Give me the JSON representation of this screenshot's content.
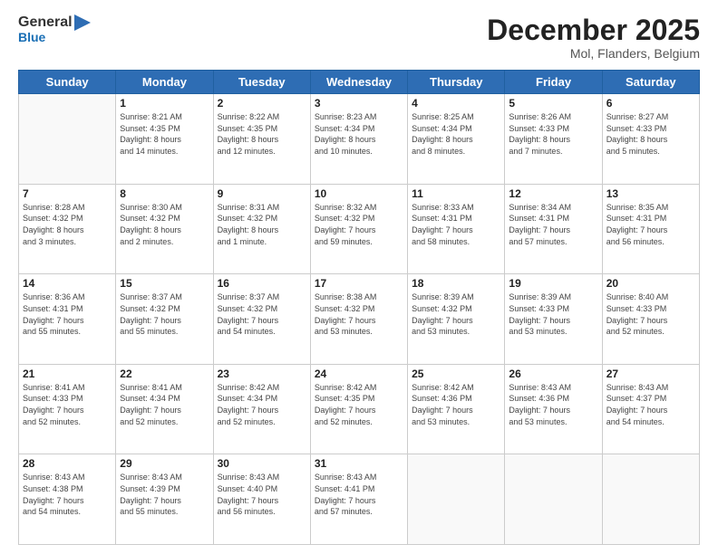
{
  "header": {
    "logo_line1": "General",
    "logo_line2": "Blue",
    "month": "December 2025",
    "location": "Mol, Flanders, Belgium"
  },
  "weekdays": [
    "Sunday",
    "Monday",
    "Tuesday",
    "Wednesday",
    "Thursday",
    "Friday",
    "Saturday"
  ],
  "weeks": [
    [
      {
        "day": "",
        "info": ""
      },
      {
        "day": "1",
        "info": "Sunrise: 8:21 AM\nSunset: 4:35 PM\nDaylight: 8 hours\nand 14 minutes."
      },
      {
        "day": "2",
        "info": "Sunrise: 8:22 AM\nSunset: 4:35 PM\nDaylight: 8 hours\nand 12 minutes."
      },
      {
        "day": "3",
        "info": "Sunrise: 8:23 AM\nSunset: 4:34 PM\nDaylight: 8 hours\nand 10 minutes."
      },
      {
        "day": "4",
        "info": "Sunrise: 8:25 AM\nSunset: 4:34 PM\nDaylight: 8 hours\nand 8 minutes."
      },
      {
        "day": "5",
        "info": "Sunrise: 8:26 AM\nSunset: 4:33 PM\nDaylight: 8 hours\nand 7 minutes."
      },
      {
        "day": "6",
        "info": "Sunrise: 8:27 AM\nSunset: 4:33 PM\nDaylight: 8 hours\nand 5 minutes."
      }
    ],
    [
      {
        "day": "7",
        "info": "Sunrise: 8:28 AM\nSunset: 4:32 PM\nDaylight: 8 hours\nand 3 minutes."
      },
      {
        "day": "8",
        "info": "Sunrise: 8:30 AM\nSunset: 4:32 PM\nDaylight: 8 hours\nand 2 minutes."
      },
      {
        "day": "9",
        "info": "Sunrise: 8:31 AM\nSunset: 4:32 PM\nDaylight: 8 hours\nand 1 minute."
      },
      {
        "day": "10",
        "info": "Sunrise: 8:32 AM\nSunset: 4:32 PM\nDaylight: 7 hours\nand 59 minutes."
      },
      {
        "day": "11",
        "info": "Sunrise: 8:33 AM\nSunset: 4:31 PM\nDaylight: 7 hours\nand 58 minutes."
      },
      {
        "day": "12",
        "info": "Sunrise: 8:34 AM\nSunset: 4:31 PM\nDaylight: 7 hours\nand 57 minutes."
      },
      {
        "day": "13",
        "info": "Sunrise: 8:35 AM\nSunset: 4:31 PM\nDaylight: 7 hours\nand 56 minutes."
      }
    ],
    [
      {
        "day": "14",
        "info": "Sunrise: 8:36 AM\nSunset: 4:31 PM\nDaylight: 7 hours\nand 55 minutes."
      },
      {
        "day": "15",
        "info": "Sunrise: 8:37 AM\nSunset: 4:32 PM\nDaylight: 7 hours\nand 55 minutes."
      },
      {
        "day": "16",
        "info": "Sunrise: 8:37 AM\nSunset: 4:32 PM\nDaylight: 7 hours\nand 54 minutes."
      },
      {
        "day": "17",
        "info": "Sunrise: 8:38 AM\nSunset: 4:32 PM\nDaylight: 7 hours\nand 53 minutes."
      },
      {
        "day": "18",
        "info": "Sunrise: 8:39 AM\nSunset: 4:32 PM\nDaylight: 7 hours\nand 53 minutes."
      },
      {
        "day": "19",
        "info": "Sunrise: 8:39 AM\nSunset: 4:33 PM\nDaylight: 7 hours\nand 53 minutes."
      },
      {
        "day": "20",
        "info": "Sunrise: 8:40 AM\nSunset: 4:33 PM\nDaylight: 7 hours\nand 52 minutes."
      }
    ],
    [
      {
        "day": "21",
        "info": "Sunrise: 8:41 AM\nSunset: 4:33 PM\nDaylight: 7 hours\nand 52 minutes."
      },
      {
        "day": "22",
        "info": "Sunrise: 8:41 AM\nSunset: 4:34 PM\nDaylight: 7 hours\nand 52 minutes."
      },
      {
        "day": "23",
        "info": "Sunrise: 8:42 AM\nSunset: 4:34 PM\nDaylight: 7 hours\nand 52 minutes."
      },
      {
        "day": "24",
        "info": "Sunrise: 8:42 AM\nSunset: 4:35 PM\nDaylight: 7 hours\nand 52 minutes."
      },
      {
        "day": "25",
        "info": "Sunrise: 8:42 AM\nSunset: 4:36 PM\nDaylight: 7 hours\nand 53 minutes."
      },
      {
        "day": "26",
        "info": "Sunrise: 8:43 AM\nSunset: 4:36 PM\nDaylight: 7 hours\nand 53 minutes."
      },
      {
        "day": "27",
        "info": "Sunrise: 8:43 AM\nSunset: 4:37 PM\nDaylight: 7 hours\nand 54 minutes."
      }
    ],
    [
      {
        "day": "28",
        "info": "Sunrise: 8:43 AM\nSunset: 4:38 PM\nDaylight: 7 hours\nand 54 minutes."
      },
      {
        "day": "29",
        "info": "Sunrise: 8:43 AM\nSunset: 4:39 PM\nDaylight: 7 hours\nand 55 minutes."
      },
      {
        "day": "30",
        "info": "Sunrise: 8:43 AM\nSunset: 4:40 PM\nDaylight: 7 hours\nand 56 minutes."
      },
      {
        "day": "31",
        "info": "Sunrise: 8:43 AM\nSunset: 4:41 PM\nDaylight: 7 hours\nand 57 minutes."
      },
      {
        "day": "",
        "info": ""
      },
      {
        "day": "",
        "info": ""
      },
      {
        "day": "",
        "info": ""
      }
    ]
  ]
}
